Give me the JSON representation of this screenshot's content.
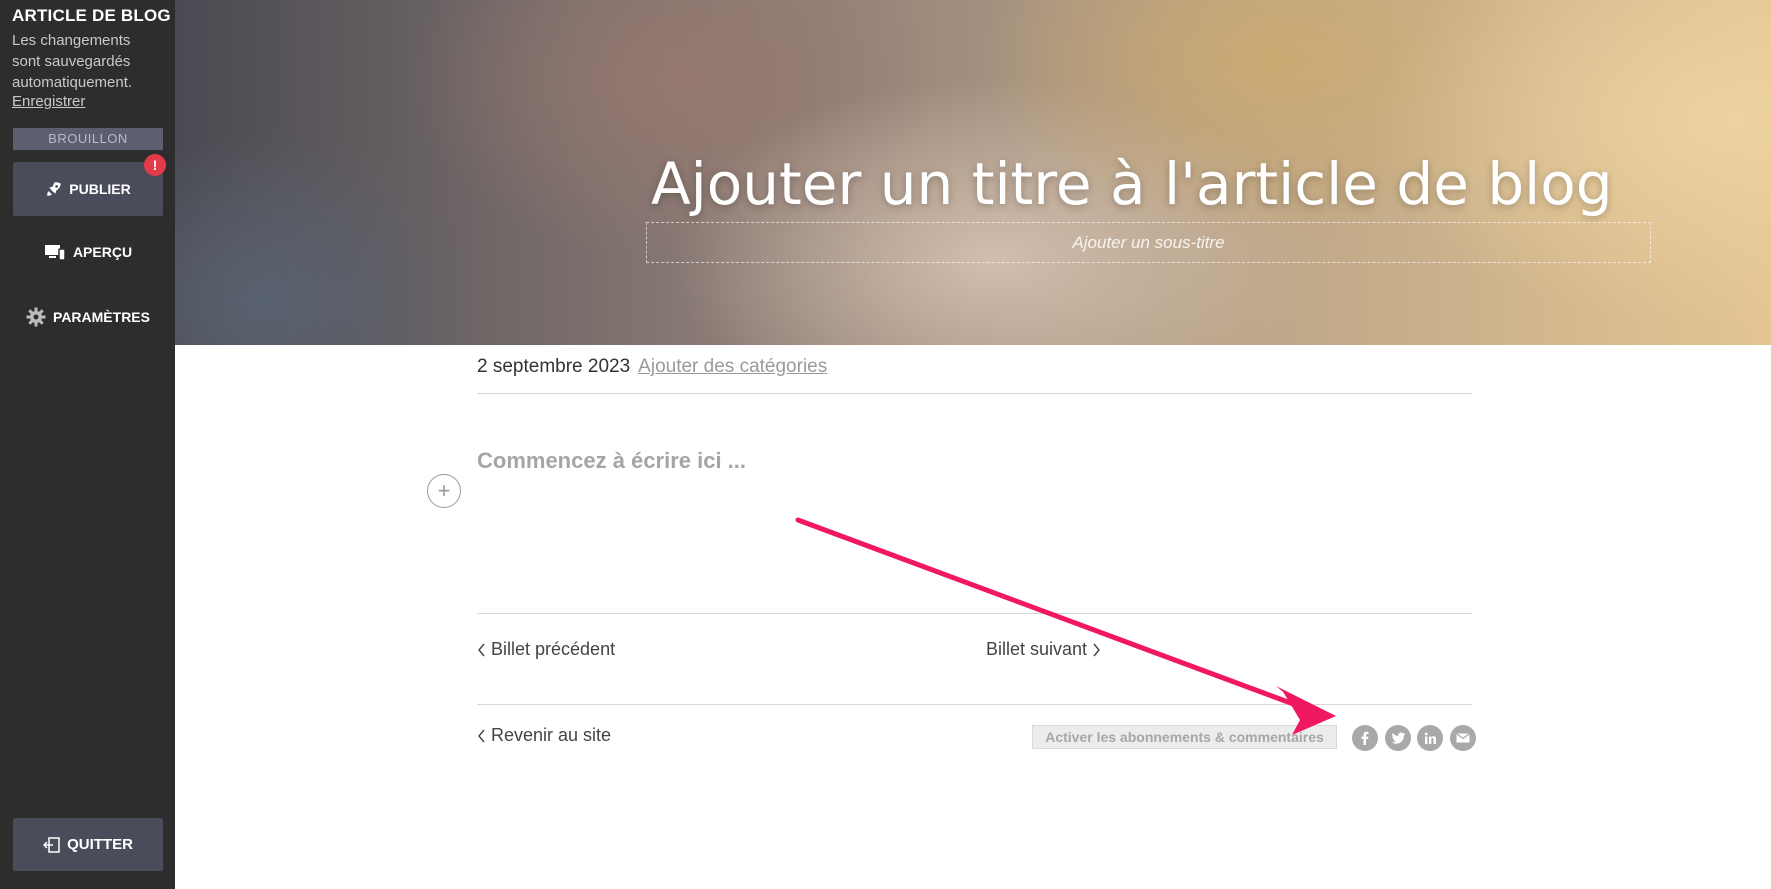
{
  "sidebar": {
    "title": "ARTICLE DE BLOG",
    "autosave_note": "Les changements sont sauvegardés automatiquement.",
    "save_link": "Enregistrer",
    "status_badge": "BROUILLON",
    "publish_label": "PUBLIER",
    "publish_alert": "!",
    "preview_label": "APERÇU",
    "settings_label": "PARAMÈTRES",
    "quit_label": "QUITTER"
  },
  "hero": {
    "title": "Ajouter un titre à l'article de blog",
    "subtitle_placeholder": "Ajouter un sous-titre"
  },
  "post": {
    "date": "2 septembre 2023",
    "add_categories": "Ajouter des catégories",
    "body_placeholder": "Commencez à écrire ici ...",
    "add_block": "+"
  },
  "navigation": {
    "previous": "Billet précédent",
    "next": "Billet suivant",
    "back": "Revenir au site"
  },
  "footer": {
    "enable_comments": "Activer les abonnements & commentaires",
    "share_icons": [
      "facebook-icon",
      "twitter-icon",
      "linkedin-icon",
      "email-icon"
    ]
  },
  "colors": {
    "sidebar_bg": "#2d2d2e",
    "button_bg": "#4a4d59",
    "alert": "#e33a4a",
    "annotation_arrow": "#f0185f"
  }
}
